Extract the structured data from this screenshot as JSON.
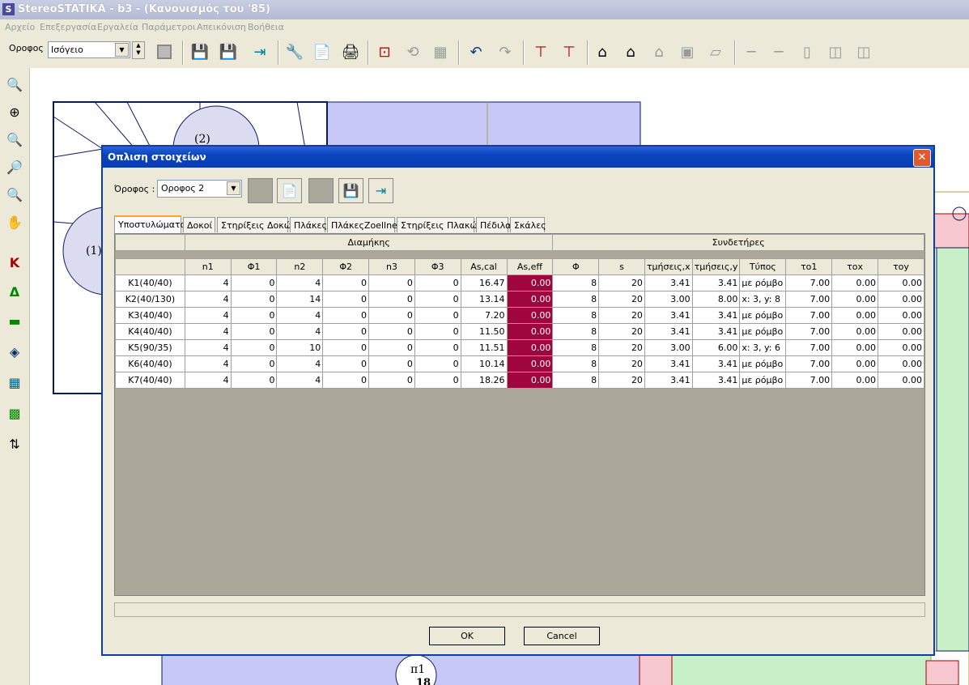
{
  "app": {
    "title": "StereoSTATIKA - b3 - (Κανονισμός του '85)",
    "icon_letter": "S",
    "menu": [
      "Αρχείο",
      "Επεξεργασία",
      "Εργαλεία",
      "Παράμετροι",
      "Απεικόνιση",
      "Βοήθεια"
    ]
  },
  "toolbar": {
    "floor_label": "Οροφος",
    "floor_value": "Ισόγειο"
  },
  "drawing": {
    "circle_labels": [
      "(2)",
      "(1)"
    ],
    "beam_label_top": "π1",
    "beam_label_bottom": "18"
  },
  "dialog": {
    "title": "Οπλιση στοιχείων",
    "floor_label": "Όροφος :",
    "floor_value": "Οροφος 2",
    "tabs": [
      "Υποστυλώματα",
      "Δοκοί",
      "Στηρίξεις Δοκών",
      "Πλάκες",
      "ΠλάκεςZoellner",
      "Στηρίξεις Πλακών",
      "Πέδιλα",
      "Σκάλες"
    ],
    "active_tab": 0,
    "group_headers": [
      "Διαμήκης",
      "Συνδετήρες"
    ],
    "columns": [
      "",
      "n1",
      "Φ1",
      "n2",
      "Φ2",
      "n3",
      "Φ3",
      "As,cal",
      "As,eff",
      "Φ",
      "s",
      "τμήσεις,x",
      "τμήσεις,y",
      "Τύπος",
      "το1",
      "τοx",
      "τoy"
    ],
    "rows": [
      [
        "K1(40/40)",
        "4",
        "0",
        "4",
        "0",
        "0",
        "0",
        "16.47",
        "0.00",
        "8",
        "20",
        "3.41",
        "3.41",
        "με ρόμβο",
        "7.00",
        "0.00",
        "0.00"
      ],
      [
        "K2(40/130)",
        "4",
        "0",
        "14",
        "0",
        "0",
        "0",
        "13.14",
        "0.00",
        "8",
        "20",
        "3.00",
        "8.00",
        "x: 3, y: 8",
        "7.00",
        "0.00",
        "0.00"
      ],
      [
        "K3(40/40)",
        "4",
        "0",
        "4",
        "0",
        "0",
        "0",
        "7.20",
        "0.00",
        "8",
        "20",
        "3.41",
        "3.41",
        "με ρόμβο",
        "7.00",
        "0.00",
        "0.00"
      ],
      [
        "K4(40/40)",
        "4",
        "0",
        "4",
        "0",
        "0",
        "0",
        "11.50",
        "0.00",
        "8",
        "20",
        "3.41",
        "3.41",
        "με ρόμβο",
        "7.00",
        "0.00",
        "0.00"
      ],
      [
        "K5(90/35)",
        "4",
        "0",
        "10",
        "0",
        "0",
        "0",
        "11.51",
        "0.00",
        "8",
        "20",
        "3.00",
        "6.00",
        "x: 3, y: 6",
        "7.00",
        "0.00",
        "0.00"
      ],
      [
        "K6(40/40)",
        "4",
        "0",
        "4",
        "0",
        "0",
        "0",
        "10.14",
        "0.00",
        "8",
        "20",
        "3.41",
        "3.41",
        "με ρόμβο",
        "7.00",
        "0.00",
        "0.00"
      ],
      [
        "K7(40/40)",
        "4",
        "0",
        "4",
        "0",
        "0",
        "0",
        "18.26",
        "0.00",
        "8",
        "20",
        "3.41",
        "3.41",
        "με ρόμβο",
        "7.00",
        "0.00",
        "0.00"
      ]
    ],
    "ok_label": "OK",
    "cancel_label": "Cancel",
    "colors": {
      "eff_cell": "#a0063e",
      "title_bar": "#0a44c0"
    }
  }
}
